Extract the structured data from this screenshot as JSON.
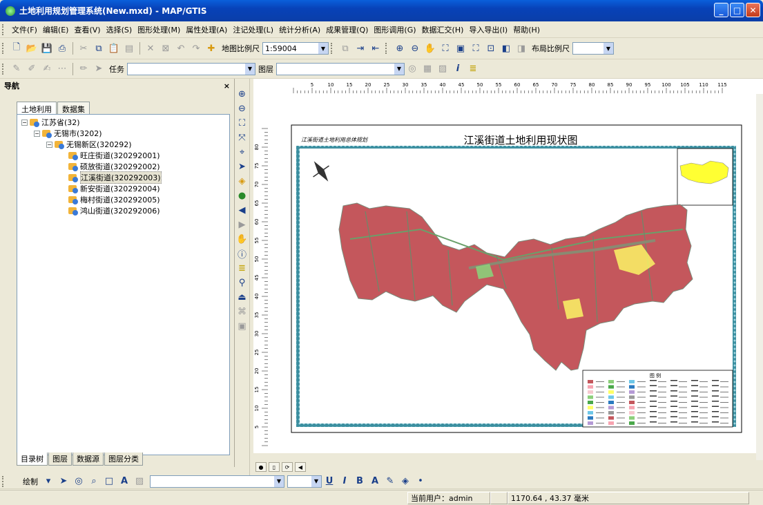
{
  "window": {
    "title": "土地利用规划管理系统(New.mxd) - MAP/GTIS"
  },
  "menu": [
    "文件(F)",
    "编辑(E)",
    "查看(V)",
    "选择(S)",
    "图形处理(M)",
    "属性处理(A)",
    "注记处理(L)",
    "统计分析(A)",
    "成果管理(Q)",
    "图形调用(G)",
    "数据汇交(H)",
    "导入导出(I)",
    "帮助(H)"
  ],
  "toolbar1": {
    "scale_label": "地图比例尺",
    "scale_value": "1:59004",
    "layout_scale_label": "布局比例尺",
    "layout_scale_value": ""
  },
  "toolbar2": {
    "task_label": "任务",
    "task_value": "",
    "layer_label": "图层",
    "layer_value": ""
  },
  "nav": {
    "title": "导航",
    "close": "×",
    "tabs": [
      "土地利用",
      "数据集"
    ],
    "tree": [
      {
        "label": "江苏省(32)",
        "level": 0
      },
      {
        "label": "无锡市(3202)",
        "level": 1
      },
      {
        "label": "无锡新区(320292)",
        "level": 2
      },
      {
        "label": "旺庄街道(320292001)",
        "level": 3
      },
      {
        "label": "硕放街道(320292002)",
        "level": 3
      },
      {
        "label": "江溪街道(320292003)",
        "level": 3,
        "selected": true
      },
      {
        "label": "新安街道(320292004)",
        "level": 3
      },
      {
        "label": "梅村街道(320292005)",
        "level": 3
      },
      {
        "label": "鸿山街道(320292006)",
        "level": 3
      }
    ],
    "bottom_tabs": [
      "目录树",
      "图层",
      "数据源",
      "图层分类"
    ]
  },
  "map": {
    "title": "江溪街道土地利用现状图",
    "subtitle": "江溪街道土地利用总体规划",
    "ruler_top": [
      "5",
      "10",
      "15",
      "20",
      "25",
      "30",
      "35",
      "40",
      "45",
      "50",
      "55",
      "60",
      "65",
      "70",
      "75",
      "80",
      "85",
      "90",
      "95",
      "100",
      "105",
      "110",
      "115"
    ],
    "ruler_left": [
      "80",
      "75",
      "70",
      "65",
      "60",
      "55",
      "50",
      "45",
      "40",
      "35",
      "30",
      "25",
      "20",
      "15",
      "10",
      "5"
    ],
    "legend_title": "图  例"
  },
  "drawbar": {
    "draw_label": "绘制",
    "font_value": "",
    "size_value": ""
  },
  "status": {
    "user": "当前用户：admin",
    "coords": "1170.64 , 43.37 毫米"
  }
}
